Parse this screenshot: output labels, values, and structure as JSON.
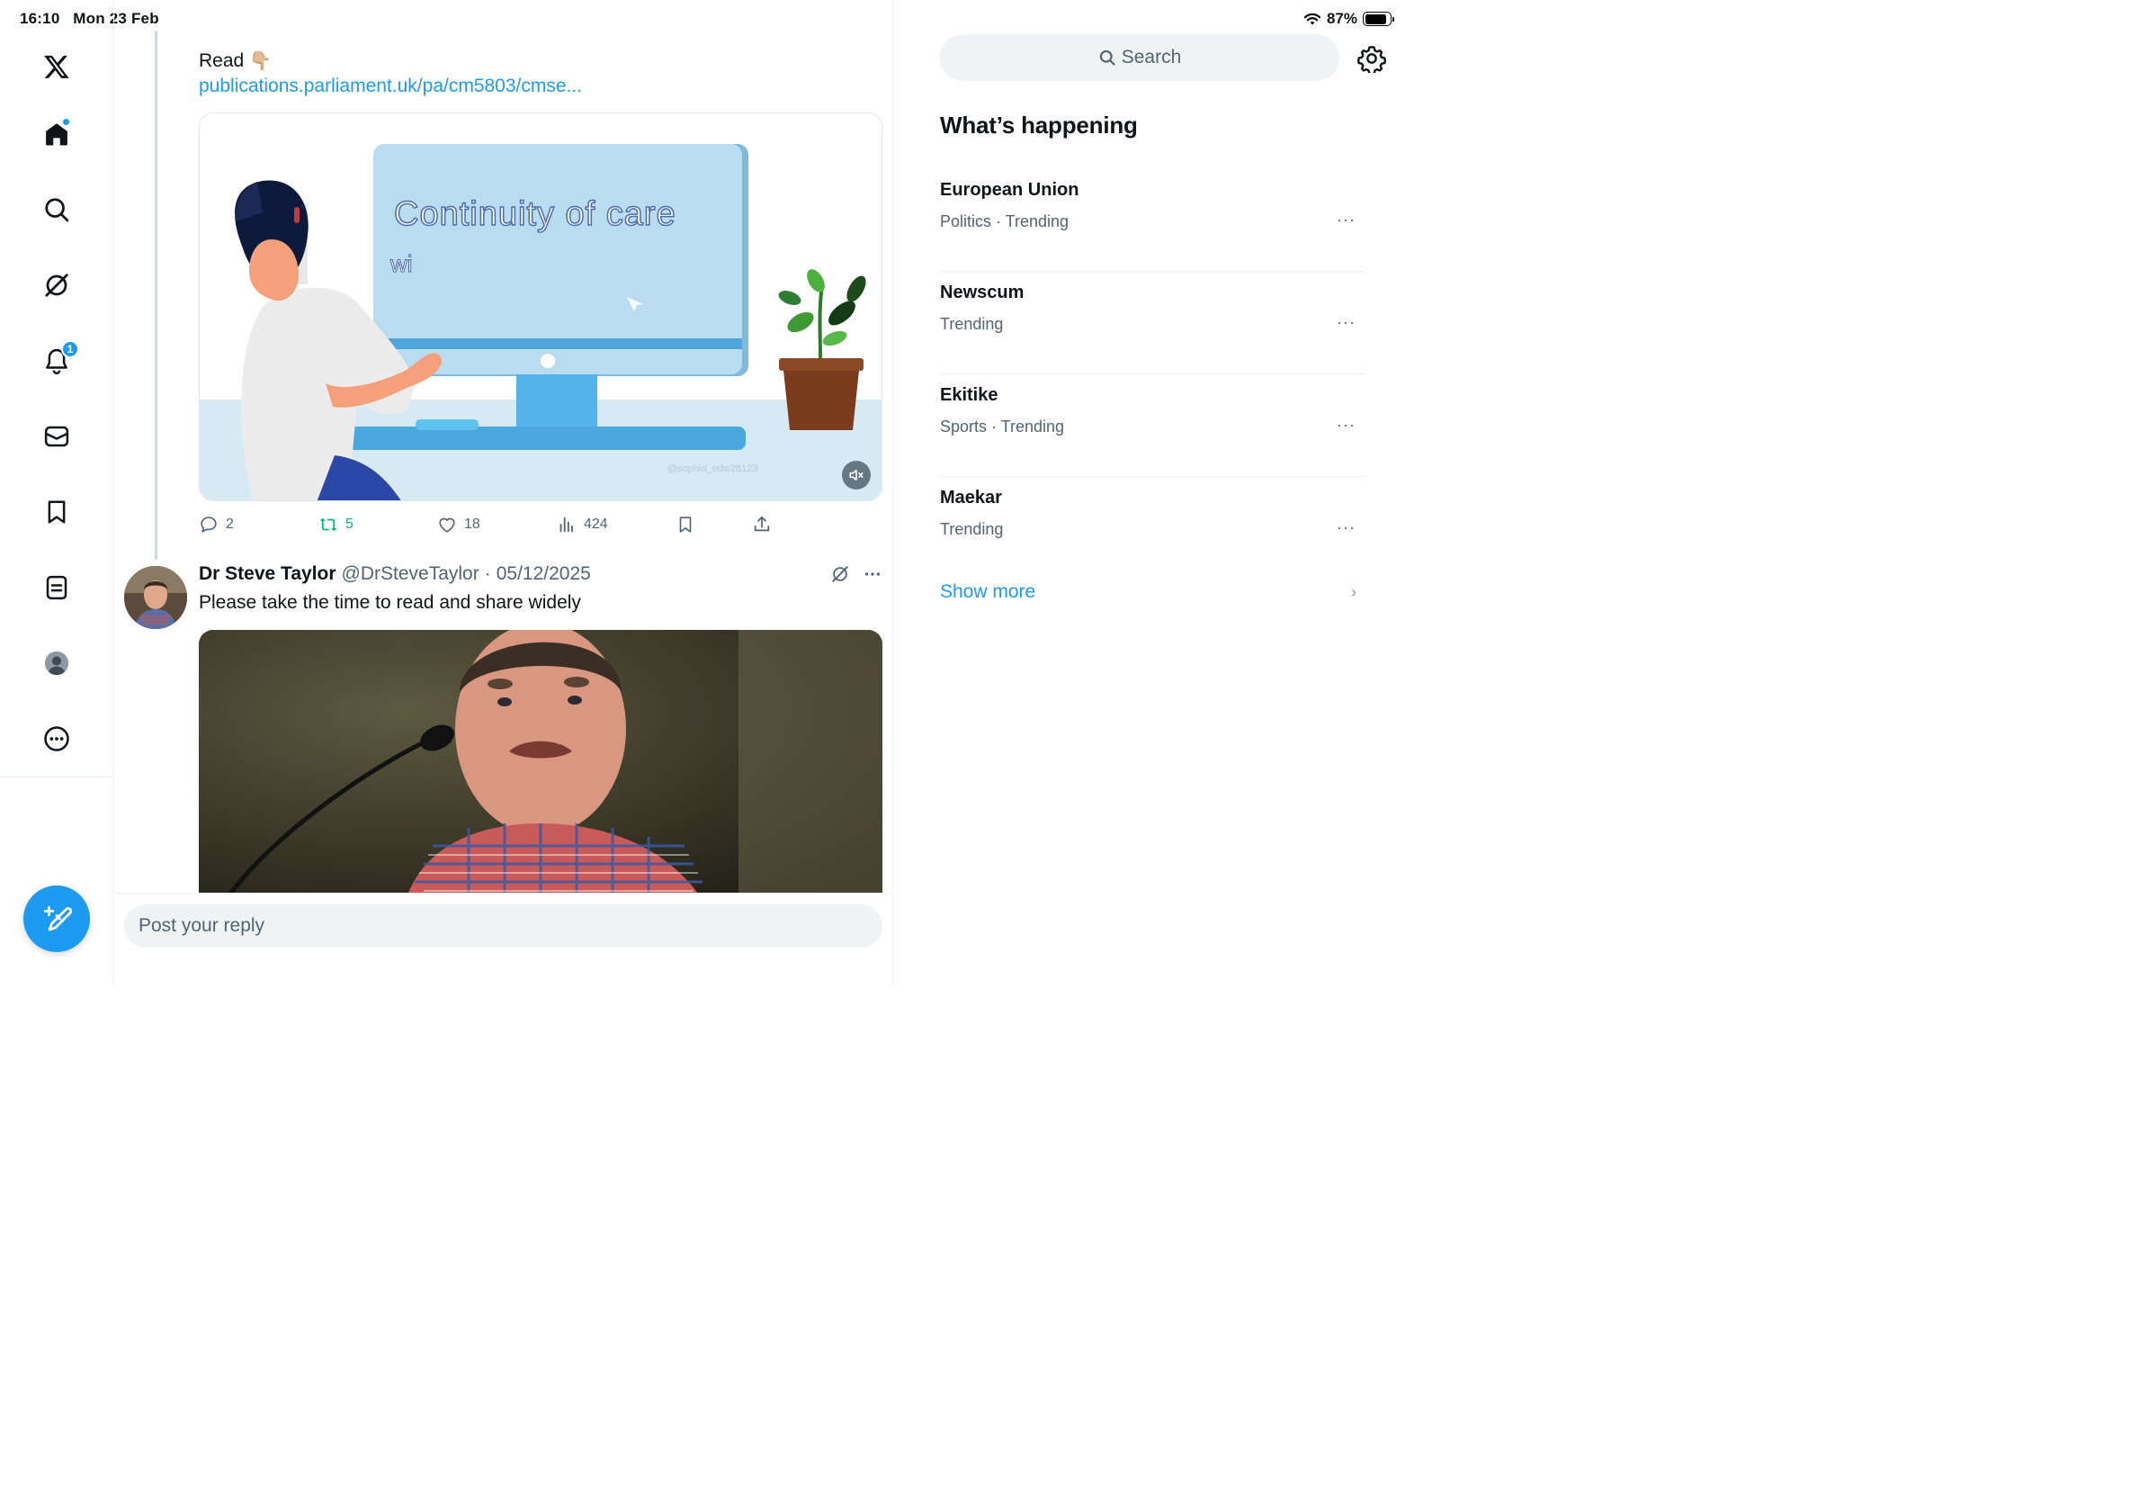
{
  "status_bar": {
    "time": "16:10",
    "date": "Mon 23 Feb",
    "battery": "87%"
  },
  "nav": {
    "items": [
      {
        "name": "x-logo-icon"
      },
      {
        "name": "home-icon"
      },
      {
        "name": "search-icon"
      },
      {
        "name": "grok-icon"
      },
      {
        "name": "notifications-icon",
        "badge": "1"
      },
      {
        "name": "messages-icon"
      },
      {
        "name": "bookmarks-icon"
      },
      {
        "name": "lists-icon"
      },
      {
        "name": "profile-icon"
      },
      {
        "name": "more-icon"
      }
    ],
    "compose_icon": "compose-icon"
  },
  "thread": {
    "post1": {
      "text": "Read",
      "emoji": "👇🏼",
      "link": "publications.parliament.uk/pa/cm5803/cmse...",
      "media": {
        "title": "Continuity of care",
        "subtitle": "wi",
        "watermark": "@sophia_edw28123"
      },
      "actions": {
        "replies": "2",
        "reposts": "5",
        "likes": "18",
        "views": "424"
      }
    },
    "post2": {
      "name": "Dr Steve Taylor",
      "handle": "@DrSteveTaylor",
      "date": "05/12/2025",
      "text": "Please take the time to read and share widely"
    },
    "reply_placeholder": "Post your reply"
  },
  "sidebar": {
    "search_placeholder": "Search",
    "title": "What’s happening",
    "trends": [
      {
        "name": "European Union",
        "meta": "Politics · Trending"
      },
      {
        "name": "Newscum",
        "meta": "Trending"
      },
      {
        "name": "Ekitike",
        "meta": "Sports · Trending"
      },
      {
        "name": "Maekar",
        "meta": "Trending"
      }
    ],
    "show_more": "Show more"
  },
  "colors": {
    "accent": "#1d9bf0",
    "repost_green": "#00ba7c",
    "muted_text": "#536471"
  }
}
